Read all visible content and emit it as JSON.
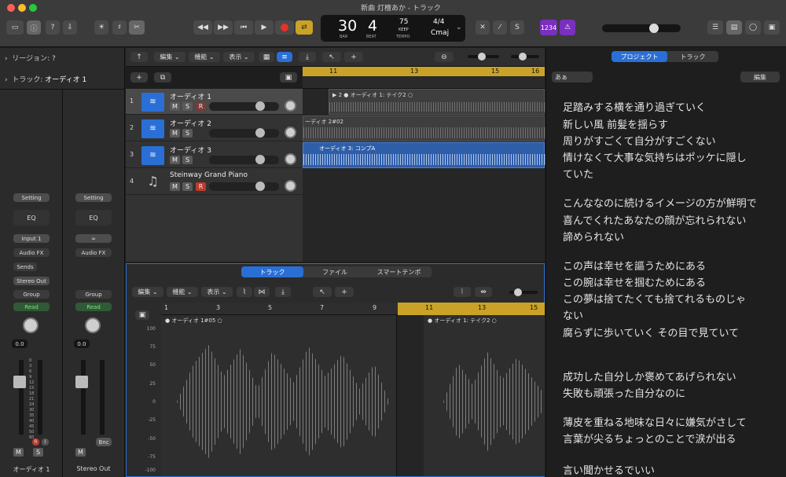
{
  "window": {
    "title": "新曲 灯檀あか - トラック"
  },
  "lcd": {
    "bar": "30",
    "beat": "4",
    "bar_label": "BAR",
    "beat_label": "BEAT",
    "tempo": "75",
    "tempo_mode": "KEEP",
    "tempo_label": "TEMPO",
    "time_sig": "4/4",
    "key": "Cmaj"
  },
  "toolbar": {
    "count_in": "1234"
  },
  "inspector": {
    "region_label": "リージョン: ?",
    "track_label": "トラック:",
    "track_name": "オーディオ 1"
  },
  "channel_strips": [
    {
      "setting": "Setting",
      "eq": "EQ",
      "input": "Input 1",
      "audio_fx": "Audio FX",
      "sends": "Sends",
      "output": "Stereo Out",
      "group": "Group",
      "automation": "Read",
      "pan": "0.0",
      "name": "オーディオ 1",
      "mute": "M",
      "solo": "S",
      "rec": "R",
      "input_mon": "I"
    },
    {
      "setting": "Setting",
      "eq": "EQ",
      "audio_fx": "Audio FX",
      "group": "Group",
      "automation": "Read",
      "pan": "0.0",
      "name": "Stereo Out",
      "mute": "M",
      "bounce": "Bnc"
    }
  ],
  "meter_scale": [
    "0",
    "3",
    "6",
    "9",
    "12",
    "15",
    "18",
    "21",
    "24",
    "30",
    "35",
    "40",
    "45",
    "50",
    "60"
  ],
  "tracks_header": {
    "edit": "編集",
    "function": "機能",
    "view": "表示"
  },
  "tracks": [
    {
      "num": "1",
      "name": "オーディオ 1",
      "m": "M",
      "s": "S",
      "r": "R"
    },
    {
      "num": "2",
      "name": "オーディオ 2",
      "m": "M",
      "s": "S"
    },
    {
      "num": "3",
      "name": "オーディオ 3",
      "m": "M",
      "s": "S"
    },
    {
      "num": "4",
      "name": "Steinway Grand Piano",
      "m": "M",
      "s": "S",
      "r": "R"
    }
  ],
  "ruler": [
    "11",
    "13",
    "15",
    "16"
  ],
  "regions": [
    {
      "name": "オーディオ 1: テイク2",
      "take": "2"
    },
    {
      "name": "ーディオ 2#02"
    },
    {
      "name": "オーディオ 3: コンプA"
    }
  ],
  "editor": {
    "tabs": [
      "トラック",
      "ファイル",
      "スマートテンポ"
    ],
    "edit": "編集",
    "function": "機能",
    "view": "表示",
    "ruler": [
      "1",
      "3",
      "5",
      "7",
      "9",
      "11",
      "13",
      "15"
    ],
    "region_a": "オーディオ 1#05",
    "region_b": "オーディオ 1: テイク2",
    "scale": [
      "100",
      "75",
      "50",
      "25",
      "0",
      "-25",
      "-50",
      "-75",
      "-100"
    ]
  },
  "lyrics_panel": {
    "tabs": [
      "プロジェクト",
      "トラック"
    ],
    "font_button": "あぁ",
    "edit_button": "編集",
    "lines": [
      "足踏みする横を通り過ぎていく",
      "新しい風 前髪を揺らす",
      "周りがすごくて自分がすごくない",
      "情けなくて大事な気持ちはポッケに隠し",
      "ていた",
      "こんななのに続けるイメージの方が鮮明で",
      "喜んでくれたあなたの顔が忘れられない",
      "諦められない",
      "この声は幸せを謳うためにある",
      "この腕は幸せを掴むためにある",
      "この夢は捨てたくても捨てれるものじゃ",
      "ない",
      "腐らずに歩いていく その目で見ていて",
      "成功した自分しか褒めてあげられない",
      "失敗も頑張った自分なのに",
      "薄皮を重ねる地味な日々に嫌気がさして",
      "言葉が尖るちょっとのことで涙が出る",
      "言い聞かせるでいい"
    ]
  },
  "colors": {
    "accent": "#2a6fd6",
    "region_blue": "#2f5ea8",
    "yellow": "#c9a227",
    "mute_blue": "#2a6fd6",
    "rec_red": "#c0392b",
    "bg": "#1e1e1e"
  }
}
